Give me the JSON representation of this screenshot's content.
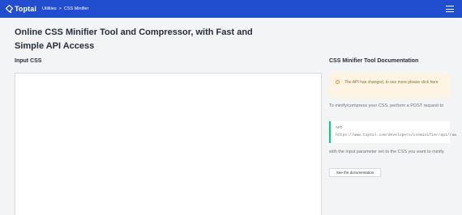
{
  "header": {
    "logo_text": "Toptal",
    "breadcrumb": {
      "parent": "Utilities",
      "separator": ">",
      "current": "CSS Minifier"
    },
    "brand_color": "#204ecf"
  },
  "page": {
    "title": "Online CSS Minifier Tool and Compressor, with Fast and Simple API Access",
    "input_label": "Input CSS",
    "input_value": ""
  },
  "docs": {
    "title": "CSS Minifier Tool Documentation",
    "alert_text": "The API has changed, to see more please click here",
    "intro": "To minify/compress your CSS, perform a POST request to",
    "api_label": "API",
    "api_url": "https://www.toptal.com/developers/cssminifier/api/raw",
    "after": "with the input parameter set to the CSS you want to minify.",
    "button": "See the documentation"
  }
}
